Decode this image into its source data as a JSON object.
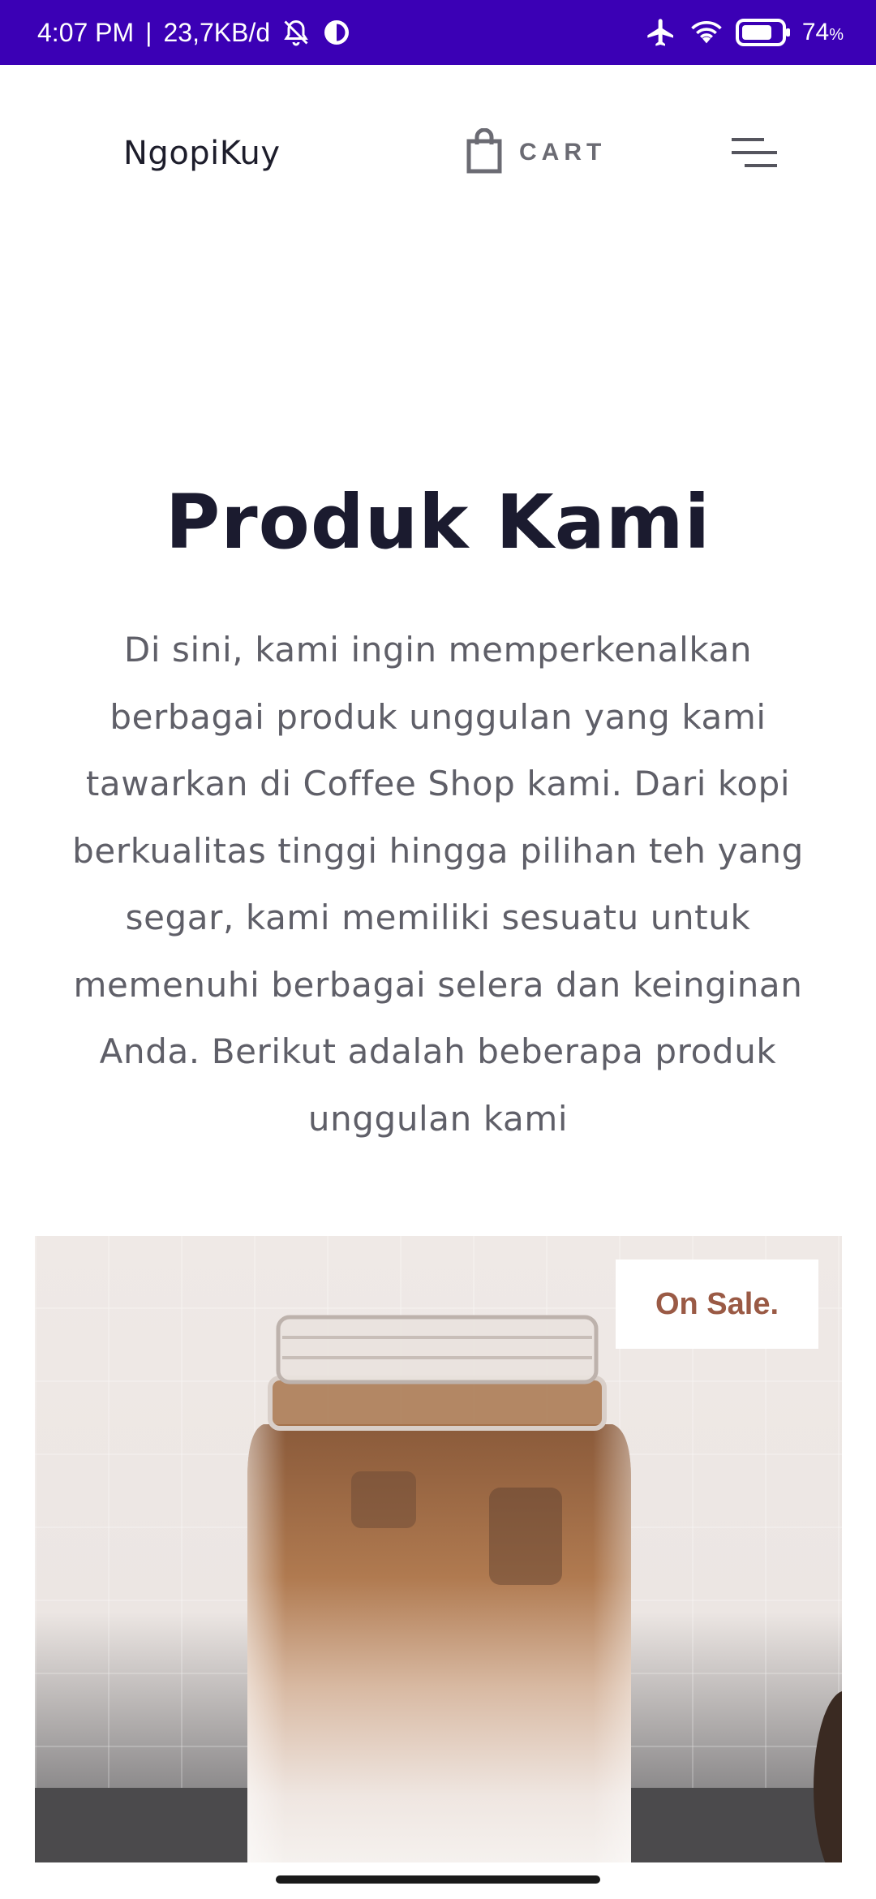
{
  "status_bar": {
    "time": "4:07 PM",
    "separator": "|",
    "net_speed": "23,7KB/d",
    "battery": "74",
    "battery_unit": "%",
    "icons": [
      "mute-bell-icon",
      "data-saver-icon",
      "airplane-icon",
      "wifi-icon",
      "battery-icon"
    ],
    "background": "#3b00b5"
  },
  "header": {
    "brand": "NgopiKuy",
    "cart_label": "CART",
    "cart_icon": "shopping-bag-icon",
    "menu_icon": "hamburger-menu-icon"
  },
  "section": {
    "title": "Produk Kami",
    "description": "Di sini, kami ingin memperkenalkan berbagai produk unggulan yang kami tawarkan di Coffee Shop kami. Dari kopi berkualitas tinggi hingga pilihan teh yang segar, kami memiliki sesuatu untuk memenuhi berbagai selera dan keinginan Anda. Berikut adalah beberapa produk unggulan kami"
  },
  "product": {
    "badge": "On Sale.",
    "badge_color": "#9a5a45",
    "image_subject": "iced-coffee-jar"
  }
}
